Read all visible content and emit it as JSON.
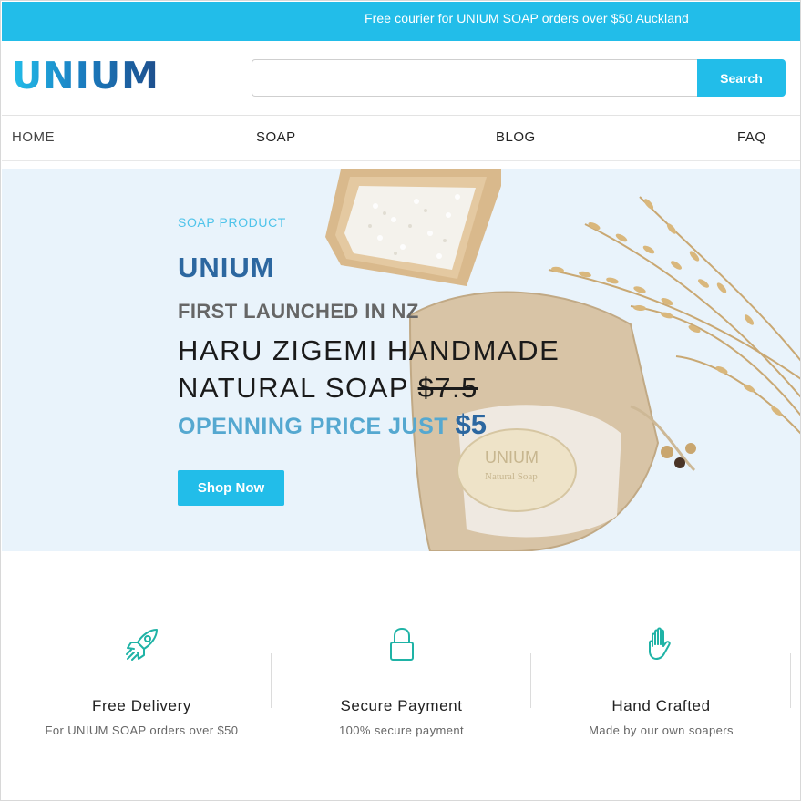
{
  "announcement": {
    "text": "Free courier for UNIUM SOAP orders over $50 Auckland"
  },
  "colors": {
    "accent": "#22bde9",
    "brand_dark": "#2c67a0",
    "feature_icon": "#1fb3a6"
  },
  "header": {
    "logo_text": "UNIUM",
    "search": {
      "value": "",
      "placeholder": "",
      "button_label": "Search"
    }
  },
  "nav": {
    "items": [
      {
        "label": "HOME"
      },
      {
        "label": "SOAP"
      },
      {
        "label": "BLOG"
      },
      {
        "label": "FAQ"
      }
    ]
  },
  "hero": {
    "eyebrow": "SOAP PRODUCT",
    "brand": "UNIUM",
    "subtitle": "FIRST LAUNCHED IN NZ",
    "title_line1": "HARU ZIGEMI HANDMADE",
    "title_line2_prefix": "NATURAL SOAP ",
    "old_price": "$7.5",
    "price_label": "OPENNING PRICE JUST ",
    "price_value": "$5",
    "cta_label": "Shop Now",
    "soap_stamp_line1": "UNIUM",
    "soap_stamp_line2": "Natural Soap"
  },
  "features": [
    {
      "icon": "rocket-icon",
      "title": "Free Delivery",
      "subtitle": "For UNIUM SOAP orders over $50"
    },
    {
      "icon": "lock-icon",
      "title": "Secure Payment",
      "subtitle": "100% secure payment"
    },
    {
      "icon": "hand-icon",
      "title": "Hand Crafted",
      "subtitle": "Made by our own soapers"
    }
  ]
}
